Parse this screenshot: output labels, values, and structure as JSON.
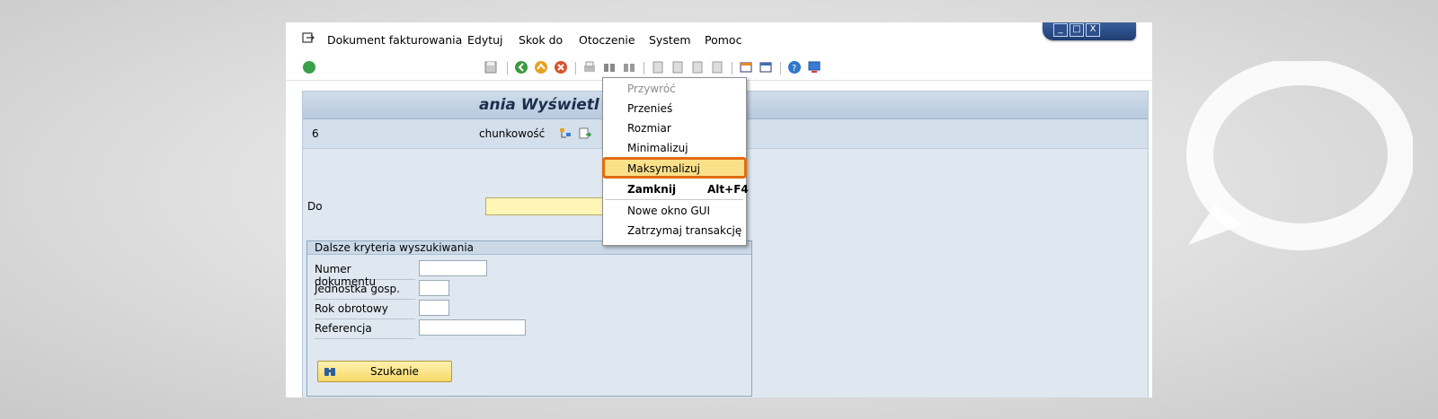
{
  "menubar": {
    "items": [
      {
        "label": "Dokument fakturowania"
      },
      {
        "label": "Edytuj"
      },
      {
        "label": "Skok do"
      },
      {
        "label": "Otoczenie"
      },
      {
        "label": "System"
      },
      {
        "label": "Pomoc"
      }
    ]
  },
  "window_controls": {
    "minimize": "_",
    "restore": "□",
    "close": "X"
  },
  "page": {
    "title": "Dokument fakturowania Wyświetl",
    "title_visible": "ania Wyświetl"
  },
  "apptoolbar": {
    "left_fragment": "6",
    "rachunkowosc_label": "chunkowość"
  },
  "main": {
    "document_label": "Do",
    "document_value": ""
  },
  "group": {
    "title": "Dalsze kryteria wyszukiwania",
    "rows": [
      {
        "label": "Numer dokumentu",
        "value": ""
      },
      {
        "label": "Jednostka gosp.",
        "value": ""
      },
      {
        "label": "Rok obrotowy",
        "value": ""
      },
      {
        "label": "Referencja",
        "value": ""
      }
    ],
    "search_button": "Szukanie"
  },
  "dropdown": {
    "items": [
      {
        "label": "Przywróć",
        "disabled": true
      },
      {
        "label": "Przenieś"
      },
      {
        "label": "Rozmiar"
      },
      {
        "label": "Minimalizuj"
      },
      {
        "label": "Maksymalizuj",
        "highlighted": true
      },
      {
        "label": "Zamknij",
        "shortcut": "Alt+F4"
      },
      {
        "label": "Nowe okno GUI"
      },
      {
        "label": "Zatrzymaj transakcję"
      }
    ]
  },
  "colors": {
    "highlight_border": "#e36b0e",
    "highlight_fill": "#fbe08a",
    "title_bg": "#c6d6e8"
  }
}
